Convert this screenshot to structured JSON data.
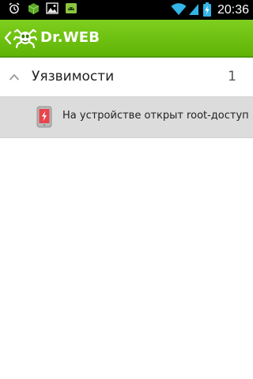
{
  "status_bar": {
    "time": "20:36",
    "left_icons": [
      "alarm-icon",
      "dr-web-cube-icon",
      "image-icon",
      "android-icon"
    ],
    "right_icons": [
      "wifi-icon",
      "signal-icon",
      "battery-charging-icon"
    ]
  },
  "action_bar": {
    "title": "Dr.WEB",
    "back_icon": "chevron-left-icon",
    "logo_icon": "dr-web-spider-logo-icon",
    "color": "#6cc20f"
  },
  "group": {
    "title": "Уязвимости",
    "count": "1",
    "expanded": true,
    "icon": "chevron-up-icon"
  },
  "items": [
    {
      "label": "На устройстве открыт root-доступ",
      "icon": "phone-alert-icon",
      "accent": "#e9434c"
    }
  ]
}
